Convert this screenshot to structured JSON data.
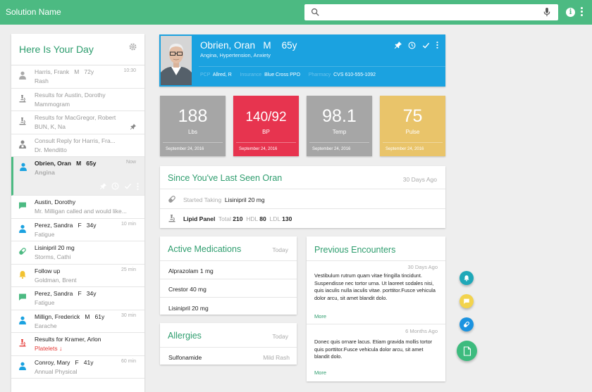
{
  "app": {
    "title": "Solution Name"
  },
  "search": {
    "placeholder": "",
    "value": ""
  },
  "day": {
    "title": "Here Is Your Day",
    "items": [
      {
        "name": "Harris, Frank",
        "sex": "M",
        "age": "72y",
        "sub": "Rash",
        "time": "10:30",
        "icon": "person-icon"
      },
      {
        "name": "Results for Austin, Dorothy",
        "sub": "Mammogram",
        "time": "",
        "icon": "microscope-icon"
      },
      {
        "name": "Results for MacGregor, Robert",
        "sub": "BUN, K, Na",
        "time": "",
        "icon": "microscope-icon"
      },
      {
        "name": "Consult Reply for Harris, Fra...",
        "sub": "Dr. Menditto",
        "time": "",
        "icon": "consult-icon"
      },
      {
        "name": "Obrien, Oran",
        "sex": "M",
        "age": "65y",
        "sub": "Angina",
        "time": "Now",
        "icon": "person-icon"
      },
      {
        "name": "Austin, Dorothy",
        "sub": "Mr. Milligan called and would like...",
        "time": "",
        "icon": "message-icon"
      },
      {
        "name": "Perez, Sandra",
        "sex": "F",
        "age": "34y",
        "sub": "Fatigue",
        "time": "10 min",
        "icon": "person-icon"
      },
      {
        "name": "Lisinipril 20 mg",
        "sub": "Storms, Cathi",
        "time": "",
        "icon": "pill-icon"
      },
      {
        "name": "Follow up",
        "sub": "Goldman, Brent",
        "time": "25 min",
        "icon": "bell-icon"
      },
      {
        "name": "Perez, Sandra",
        "sex": "F",
        "age": "34y",
        "sub": "Fatigue",
        "time": "",
        "icon": "message-icon"
      },
      {
        "name": "Millign, Frederick",
        "sex": "M",
        "age": "61y",
        "sub": "Earache",
        "time": "30 min",
        "icon": "person-icon"
      },
      {
        "name": "Results for Kramer, Arlon",
        "sub": "Platelets",
        "time": "",
        "icon": "microscope-icon"
      },
      {
        "name": "Conroy, Mary",
        "sex": "F",
        "age": "41y",
        "sub": "Annual Physical",
        "time": "60 min",
        "icon": "person-icon"
      }
    ]
  },
  "patient": {
    "name": "Obrien, Oran",
    "sex": "M",
    "age": "65y",
    "conditions": "Angina, Hypertension, Anxiety",
    "pcp_label": "PCP",
    "pcp": "Allred, R",
    "insurance_label": "Insurance",
    "insurance": "Blue Cross PPO",
    "pharmacy_label": "Pharmacy",
    "pharmacy": "CVS 610-555-1092"
  },
  "vitals": [
    {
      "value": "188",
      "label": "Lbs",
      "date": "September 24, 2016",
      "color": "#a6a6a6"
    },
    {
      "value": "140/92",
      "label": "BP",
      "date": "September 24, 2016",
      "color": "#e7344f"
    },
    {
      "value": "98.1",
      "label": "Temp",
      "date": "September 24, 2016",
      "color": "#a6a6a6"
    },
    {
      "value": "75",
      "label": "Pulse",
      "date": "September 24, 2016",
      "color": "#e9c46a"
    }
  ],
  "since": {
    "title": "Since You've Last Seen Oran",
    "ago": "30 Days Ago",
    "med_prefix": "Started Taking",
    "med": "Lisinipril 20 mg",
    "lab_name": "Lipid Panel",
    "total_label": "Total",
    "total": "210",
    "hdl_label": "HDL",
    "hdl": "80",
    "ldl_label": "LDL",
    "ldl": "130"
  },
  "medications": {
    "title": "Active Medications",
    "when": "Today",
    "items": [
      "Alprazolam 1 mg",
      "Crestor 40 mg",
      "Lisinipril 20 mg"
    ]
  },
  "allergies": {
    "title": "Allergies",
    "when": "Today",
    "items": [
      {
        "name": "Sulfonamide",
        "reaction": "Mild Rash"
      }
    ]
  },
  "encounters": {
    "title": "Previous Encounters",
    "items": [
      {
        "date": "30 Days Ago",
        "text": "Vestibulum rutrum quam vitae fringilla tincidunt. Suspendisse nec tortor urna. Ut laoreet sodales nisi, quis iaculis nulla iaculis vitae. porttitor.Fusce vehicula dolor arcu, sit amet blandit dolo.",
        "more": "More"
      },
      {
        "date": "6 Months Ago",
        "text": "Donec quis ornare lacus. Etiam gravida mollis tortor quis porttitor.Fusce vehicula dolor arcu, sit amet blandit dolo.",
        "more": "More"
      }
    ]
  },
  "colors": {
    "brand": "#4cba82",
    "patient": "#1ba2e0",
    "fab_teal": "#1fa8b8",
    "fab_yellow": "#f2d34d",
    "fab_blue": "#1b93e0",
    "fab_green": "#3dbb7e"
  }
}
